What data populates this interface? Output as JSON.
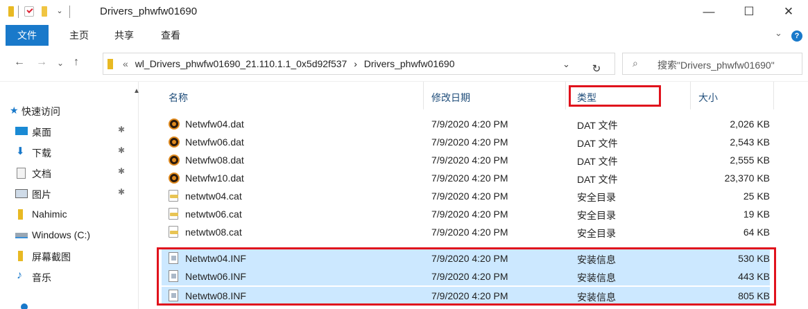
{
  "window": {
    "title": "Drivers_phwfw01690",
    "minimize": "—",
    "maximize": "☐",
    "close": "✕"
  },
  "ribbon": {
    "tabs": [
      {
        "label": "文件",
        "active": true
      },
      {
        "label": "主页",
        "active": false
      },
      {
        "label": "共享",
        "active": false
      },
      {
        "label": "查看",
        "active": false
      }
    ],
    "help": "?"
  },
  "nav": {
    "back": "←",
    "forward": "→",
    "recent": "⌄",
    "up": "↑",
    "breadcrumb_prefix": "«",
    "breadcrumb": [
      "wl_Drivers_phwfw01690_21.110.1.1_0x5d92f537",
      "Drivers_phwfw01690"
    ],
    "separator": "›",
    "dropdown": "⌄",
    "refresh": "↻",
    "search_placeholder": "搜索\"Drivers_phwfw01690\""
  },
  "sidebar": {
    "items": [
      {
        "label": "快速访问",
        "icon": "star-icon",
        "pinned": false
      },
      {
        "label": "桌面",
        "icon": "desktop-icon",
        "pinned": true
      },
      {
        "label": "下载",
        "icon": "download-icon",
        "pinned": true
      },
      {
        "label": "文档",
        "icon": "document-icon",
        "pinned": true
      },
      {
        "label": "图片",
        "icon": "pictures-icon",
        "pinned": true
      },
      {
        "label": "Nahimic",
        "icon": "folder-icon",
        "pinned": false
      },
      {
        "label": "Windows (C:)",
        "icon": "drive-icon",
        "pinned": false
      },
      {
        "label": "屏幕截图",
        "icon": "folder-icon",
        "pinned": false
      },
      {
        "label": "音乐",
        "icon": "music-icon",
        "pinned": false
      }
    ]
  },
  "columns": {
    "name": "名称",
    "date": "修改日期",
    "type": "类型",
    "size": "大小"
  },
  "files": [
    {
      "name": "Netwfw04.dat",
      "date": "7/9/2020 4:20 PM",
      "type": "DAT 文件",
      "size": "2,026 KB",
      "icon": "dat-file-icon",
      "selected": false
    },
    {
      "name": "Netwfw06.dat",
      "date": "7/9/2020 4:20 PM",
      "type": "DAT 文件",
      "size": "2,543 KB",
      "icon": "dat-file-icon",
      "selected": false
    },
    {
      "name": "Netwfw08.dat",
      "date": "7/9/2020 4:20 PM",
      "type": "DAT 文件",
      "size": "2,555 KB",
      "icon": "dat-file-icon",
      "selected": false
    },
    {
      "name": "Netwfw10.dat",
      "date": "7/9/2020 4:20 PM",
      "type": "DAT 文件",
      "size": "23,370 KB",
      "icon": "dat-file-icon",
      "selected": false
    },
    {
      "name": "netwtw04.cat",
      "date": "7/9/2020 4:20 PM",
      "type": "安全目录",
      "size": "25 KB",
      "icon": "cat-file-icon",
      "selected": false
    },
    {
      "name": "netwtw06.cat",
      "date": "7/9/2020 4:20 PM",
      "type": "安全目录",
      "size": "19 KB",
      "icon": "cat-file-icon",
      "selected": false
    },
    {
      "name": "netwtw08.cat",
      "date": "7/9/2020 4:20 PM",
      "type": "安全目录",
      "size": "64 KB",
      "icon": "cat-file-icon",
      "selected": false
    },
    {
      "name": "Netwtw04.INF",
      "date": "7/9/2020 4:20 PM",
      "type": "安装信息",
      "size": "530 KB",
      "icon": "inf-file-icon",
      "selected": true
    },
    {
      "name": "Netwtw06.INF",
      "date": "7/9/2020 4:20 PM",
      "type": "安装信息",
      "size": "443 KB",
      "icon": "inf-file-icon",
      "selected": true
    },
    {
      "name": "Netwtw08.INF",
      "date": "7/9/2020 4:20 PM",
      "type": "安装信息",
      "size": "805 KB",
      "icon": "inf-file-icon",
      "selected": true
    }
  ],
  "colors": {
    "accent": "#1979ca",
    "selection": "#cce8ff",
    "highlight_box": "#e0121c"
  }
}
